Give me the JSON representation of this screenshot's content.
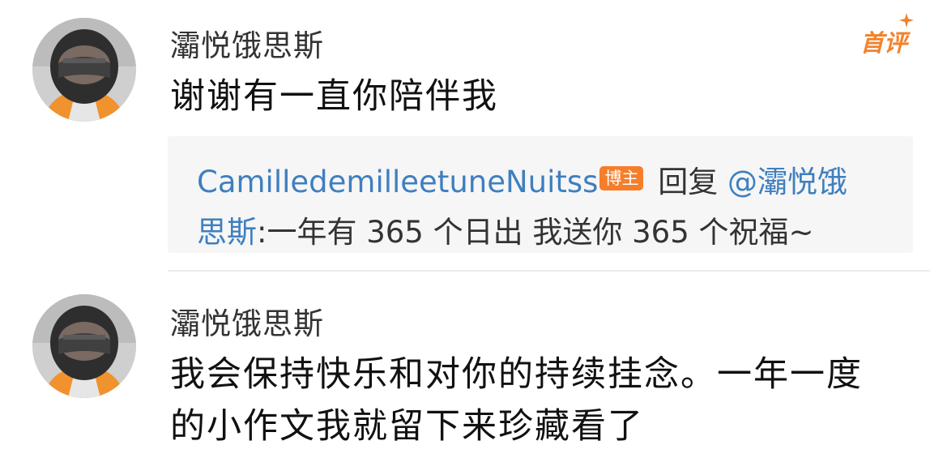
{
  "comments": [
    {
      "username": "灞悦饿思斯",
      "text": "谢谢有一直你陪伴我",
      "badge": "首评",
      "reply": {
        "author": "CamilledemilleetuneNuitss",
        "author_badge": "博主",
        "reply_word": "回复",
        "mention_line1": "@灞悦饿",
        "mention_line2": "思斯",
        "content": ":一年有 365 个日出 我送你 365 个祝福~"
      }
    },
    {
      "username": "灞悦饿思斯",
      "text_line1": "我会保持快乐和对你的持续挂念。一年一度",
      "text_line2": "的小作文我就留下来珍藏看了"
    }
  ],
  "colors": {
    "accent_orange": "#f2822c",
    "link_blue": "#3f7fbf",
    "reply_bg": "#f6f6f6"
  }
}
